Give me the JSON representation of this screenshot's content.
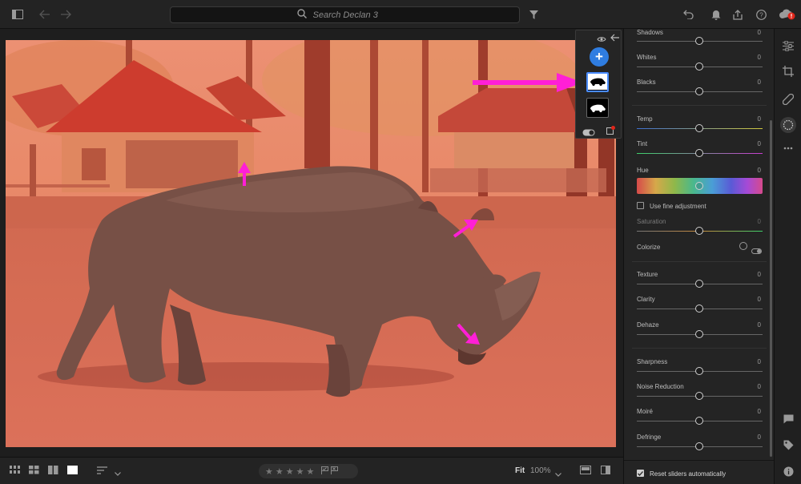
{
  "topbar": {
    "search_placeholder": "Search Declan 3"
  },
  "masks": {
    "add_label": "+"
  },
  "panel": {
    "sliders": [
      {
        "label": "Shadows",
        "value": "0",
        "pos": 0.5
      },
      {
        "label": "Whites",
        "value": "0",
        "pos": 0.5
      },
      {
        "label": "Blacks",
        "value": "0",
        "pos": 0.5
      },
      {
        "label": "Temp",
        "value": "0",
        "pos": 0.5
      },
      {
        "label": "Tint",
        "value": "0",
        "pos": 0.5
      },
      {
        "label": "Hue",
        "value": "0",
        "pos": 0.5
      },
      {
        "label": "Saturation",
        "value": "0",
        "pos": 0.5
      },
      {
        "label": "Texture",
        "value": "0",
        "pos": 0.5
      },
      {
        "label": "Clarity",
        "value": "0",
        "pos": 0.5
      },
      {
        "label": "Dehaze",
        "value": "0",
        "pos": 0.5
      },
      {
        "label": "Sharpness",
        "value": "0",
        "pos": 0.5
      },
      {
        "label": "Noise Reduction",
        "value": "0",
        "pos": 0.5
      },
      {
        "label": "Moiré",
        "value": "0",
        "pos": 0.5
      },
      {
        "label": "Defringe",
        "value": "0",
        "pos": 0.5
      }
    ],
    "fine_adjustment": "Use fine adjustment",
    "colorize": "Colorize",
    "reset_label": "Reset sliders automatically"
  },
  "bottombar": {
    "fit_label": "Fit",
    "zoom": "100%"
  },
  "colors": {
    "accent": "#2f7de1",
    "arrow": "#ff1fd6",
    "overlay": "#ff4a3a"
  }
}
